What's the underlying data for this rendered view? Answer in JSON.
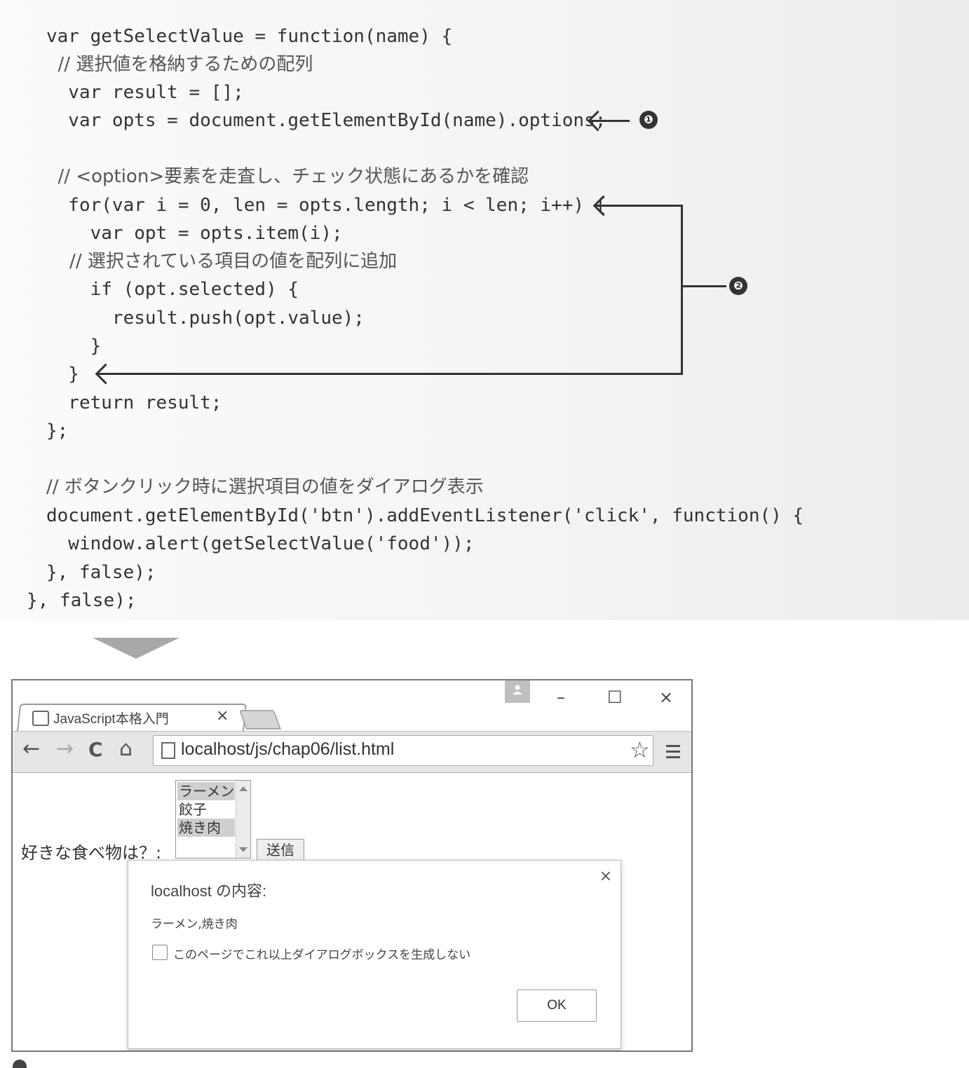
{
  "code": {
    "lines": [
      "var getSelectValue = function(name) {",
      "  // 選択値を格納するための配列",
      "  var result = [];",
      "  var opts = document.getElementById(name).options;",
      "",
      "  // <option>要素を走査し、チェック状態にあるかを確認",
      "  for(var i = 0, len = opts.length; i < len; i++) {",
      "    var opt = opts.item(i);",
      "    // 選択されている項目の値を配列に追加",
      "    if (opt.selected) {",
      "      result.push(opt.value);",
      "    }",
      "  }",
      "  return result;",
      "};",
      "",
      "// ボタンクリック時に選択項目の値をダイアログ表示",
      "document.getElementById('btn').addEventListener('click', function() {",
      "  window.alert(getSelectValue('food'));",
      "}, false);",
      "}, false);"
    ],
    "badges": [
      "❶",
      "❷"
    ]
  },
  "browser": {
    "tab_title": "JavaScript本格入門",
    "tab_close": "×",
    "window_controls": {
      "minimize": "–",
      "maximize": "☐",
      "close": "×"
    },
    "nav": {
      "back": "←",
      "forward": "→",
      "reload": "C",
      "home": "⌂"
    },
    "url": "localhost/js/chap06/list.html",
    "star": "☆"
  },
  "page": {
    "label": "好きな食べ物は？:",
    "options": [
      {
        "text": "ラーメン",
        "selected": true
      },
      {
        "text": "餃子",
        "selected": false
      },
      {
        "text": "焼き肉",
        "selected": true
      }
    ],
    "submit_label": "送信"
  },
  "dialog": {
    "title": "localhost の内容:",
    "message": "ラーメン,焼き肉",
    "checkbox_label": "このページでこれ以上ダイアログボックスを生成しない",
    "ok_label": "OK",
    "close": "×"
  },
  "icons": {
    "tab_favicon": "page-favicon-icon",
    "profile": "profile-icon",
    "page": "page-icon",
    "bookmark": "star-icon",
    "menu": "hamburger-menu-icon"
  }
}
